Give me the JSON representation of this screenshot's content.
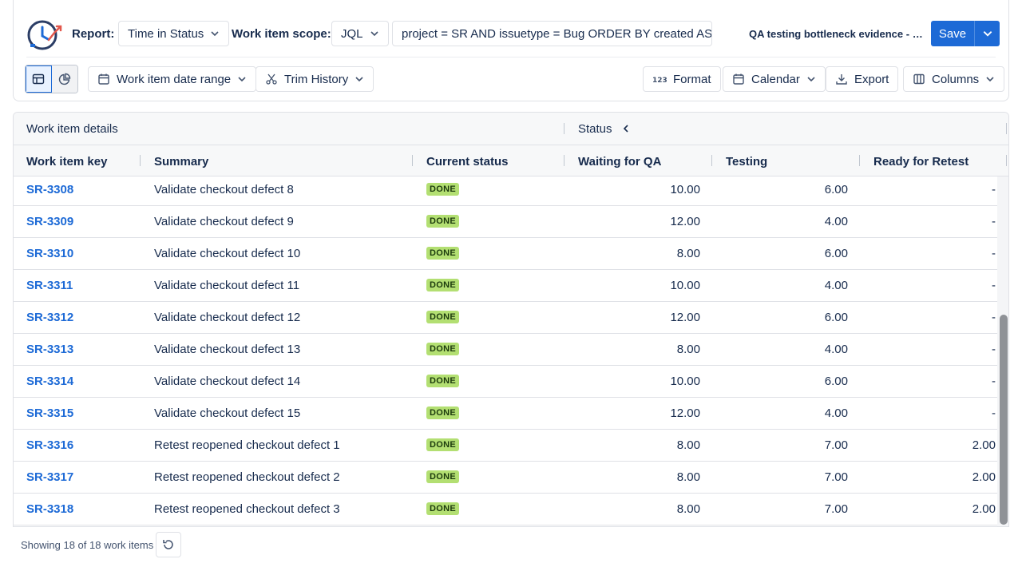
{
  "header": {
    "report_label": "Report:",
    "report_value": "Time in Status",
    "scope_label": "Work item scope:",
    "scope_value": "JQL",
    "jql": "project = SR AND issuetype = Bug ORDER BY created ASC",
    "report_name": "QA testing bottleneck evidence - checkout regressions",
    "save_label": "Save"
  },
  "toolbar": {
    "date_range": "Work item date range",
    "trim_history": "Trim History",
    "format": "Format",
    "calendar": "Calendar",
    "export": "Export",
    "columns": "Columns"
  },
  "table": {
    "groups": {
      "details": "Work item details",
      "status": "Status"
    },
    "columns": [
      "Work item key",
      "Summary",
      "Current status",
      "Waiting for QA",
      "Testing",
      "Ready for Retest"
    ],
    "rows": [
      {
        "key": "SR-3308",
        "summary": "Validate checkout defect 8",
        "status": "DONE",
        "waiting": "10.00",
        "testing": "6.00",
        "retest": "-"
      },
      {
        "key": "SR-3309",
        "summary": "Validate checkout defect 9",
        "status": "DONE",
        "waiting": "12.00",
        "testing": "4.00",
        "retest": "-"
      },
      {
        "key": "SR-3310",
        "summary": "Validate checkout defect 10",
        "status": "DONE",
        "waiting": "8.00",
        "testing": "6.00",
        "retest": "-"
      },
      {
        "key": "SR-3311",
        "summary": "Validate checkout defect 11",
        "status": "DONE",
        "waiting": "10.00",
        "testing": "4.00",
        "retest": "-"
      },
      {
        "key": "SR-3312",
        "summary": "Validate checkout defect 12",
        "status": "DONE",
        "waiting": "12.00",
        "testing": "6.00",
        "retest": "-"
      },
      {
        "key": "SR-3313",
        "summary": "Validate checkout defect 13",
        "status": "DONE",
        "waiting": "8.00",
        "testing": "4.00",
        "retest": "-"
      },
      {
        "key": "SR-3314",
        "summary": "Validate checkout defect 14",
        "status": "DONE",
        "waiting": "10.00",
        "testing": "6.00",
        "retest": "-"
      },
      {
        "key": "SR-3315",
        "summary": "Validate checkout defect 15",
        "status": "DONE",
        "waiting": "12.00",
        "testing": "4.00",
        "retest": "-"
      },
      {
        "key": "SR-3316",
        "summary": "Retest reopened checkout defect 1",
        "status": "DONE",
        "waiting": "8.00",
        "testing": "7.00",
        "retest": "2.00"
      },
      {
        "key": "SR-3317",
        "summary": "Retest reopened checkout defect 2",
        "status": "DONE",
        "waiting": "8.00",
        "testing": "7.00",
        "retest": "2.00"
      },
      {
        "key": "SR-3318",
        "summary": "Retest reopened checkout defect 3",
        "status": "DONE",
        "waiting": "8.00",
        "testing": "7.00",
        "retest": "2.00"
      }
    ]
  },
  "footer": {
    "count_text": "Showing 18 of 18 work items"
  },
  "colors": {
    "accent": "#1d6ad6",
    "done_lozenge": "#b3df72",
    "border": "#dfe1e6"
  }
}
